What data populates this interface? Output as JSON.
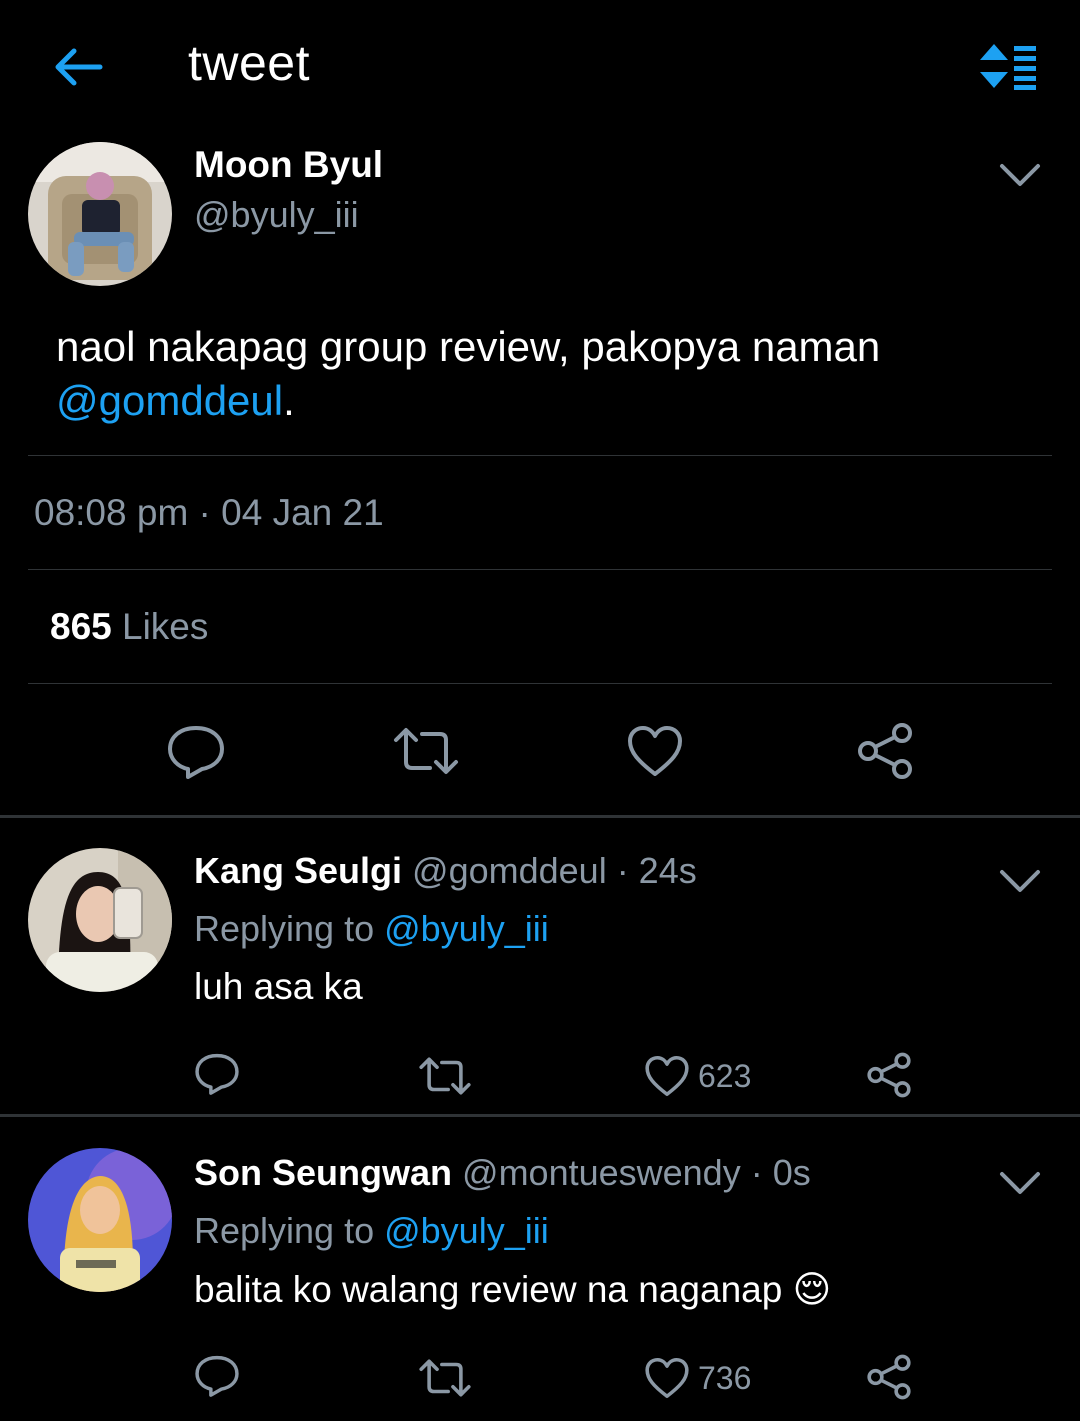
{
  "header": {
    "title": "tweet"
  },
  "tweet": {
    "name": "Moon Byul",
    "handle": "@byuly_iii",
    "text": "naol nakapag group review, pakopya naman",
    "mention": "@gomddeul",
    "text_end": ".",
    "timestamp": "08:08 pm · 04 Jan 21",
    "likes_count": "865",
    "likes_label": " Likes"
  },
  "replies": [
    {
      "name": "Kang Seulgi",
      "meta": " @gomddeul · 24s",
      "replying_prefix": "Replying to ",
      "replying_handle": "@byuly_iii",
      "text": "luh asa ka",
      "like_count": "623"
    },
    {
      "name": "Son Seungwan",
      "meta": " @montueswendy · 0s",
      "replying_prefix": "Replying to ",
      "replying_handle": "@byuly_iii",
      "text": "balita ko walang review na naganap 😌",
      "like_count": "736"
    }
  ],
  "colors": {
    "accent": "#1da1f2",
    "secondary_text": "#8b98a5",
    "divider": "#2f3336"
  },
  "icons": [
    "back-arrow-icon",
    "sort-icon",
    "chevron-down-icon",
    "reply-icon",
    "retweet-icon",
    "heart-icon",
    "share-icon"
  ]
}
